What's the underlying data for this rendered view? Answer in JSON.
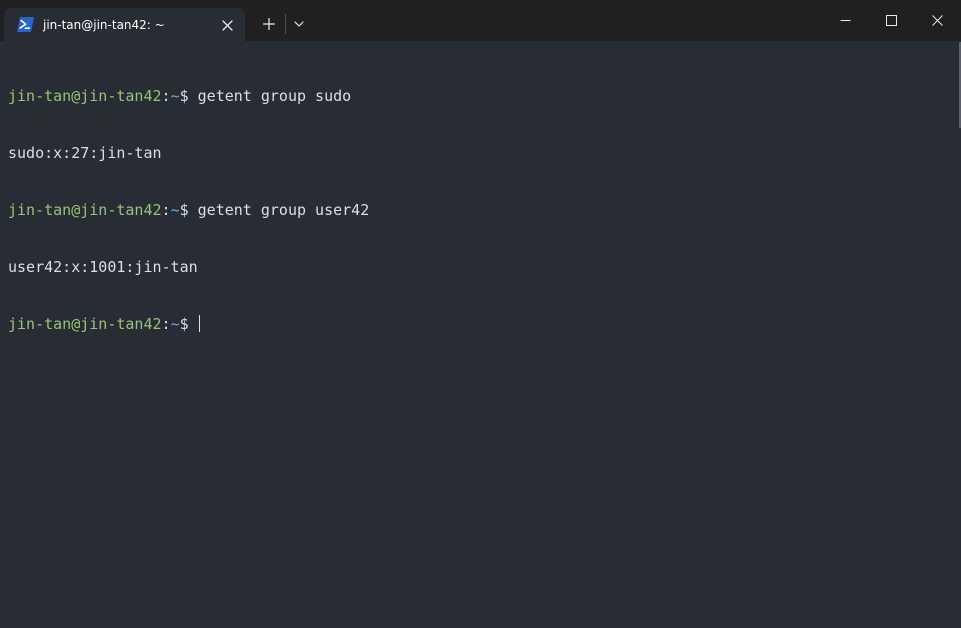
{
  "window": {
    "tab_title": "jin-tan@jin-tan42: ~",
    "tab_icon": "powershell-icon",
    "controls": {
      "new_tab_icon": "plus-icon",
      "dropdown_icon": "chevron-down-icon",
      "minimize_icon": "minimize-icon",
      "maximize_icon": "maximize-icon",
      "close_icon": "close-icon"
    }
  },
  "colors": {
    "background": "#282c34",
    "titlebar": "#202020",
    "prompt_user": "#98c379",
    "prompt_path": "#61afef",
    "text": "#dcdfe4"
  },
  "terminal": {
    "lines": [
      {
        "user": "jin-tan@jin-tan42",
        "sep": ":",
        "path": "~",
        "symbol": "$ ",
        "command": "getent group sudo"
      },
      {
        "output": "sudo:x:27:jin-tan"
      },
      {
        "user": "jin-tan@jin-tan42",
        "sep": ":",
        "path": "~",
        "symbol": "$ ",
        "command": "getent group user42"
      },
      {
        "output": "user42:x:1001:jin-tan"
      },
      {
        "user": "jin-tan@jin-tan42",
        "sep": ":",
        "path": "~",
        "symbol": "$ ",
        "command": ""
      }
    ]
  }
}
